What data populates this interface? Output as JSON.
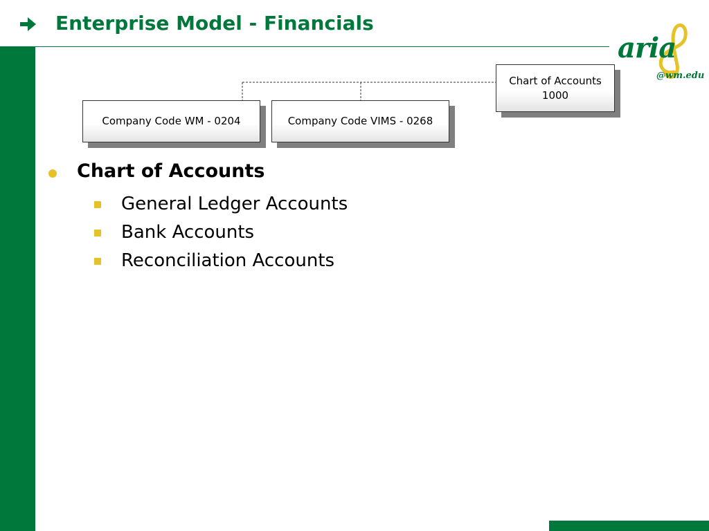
{
  "slide": {
    "title": "Enterprise Model - Financials",
    "title_icon": "right-arrow-icon"
  },
  "logo": {
    "word": "aria",
    "sub": "@wm.edu",
    "icon": "treble-clef-icon"
  },
  "org_chart": {
    "root": {
      "line1": "Chart of Accounts",
      "line2": "1000"
    },
    "children": [
      {
        "label": "Company Code WM - 0204"
      },
      {
        "label": "Company Code VIMS - 0268"
      }
    ]
  },
  "content": {
    "heading": "Chart of Accounts",
    "items": [
      "General Ledger Accounts",
      "Bank Accounts",
      "Reconciliation Accounts"
    ]
  },
  "colors": {
    "brand_green": "#00773b",
    "bullet_gold": "#e6c229"
  }
}
